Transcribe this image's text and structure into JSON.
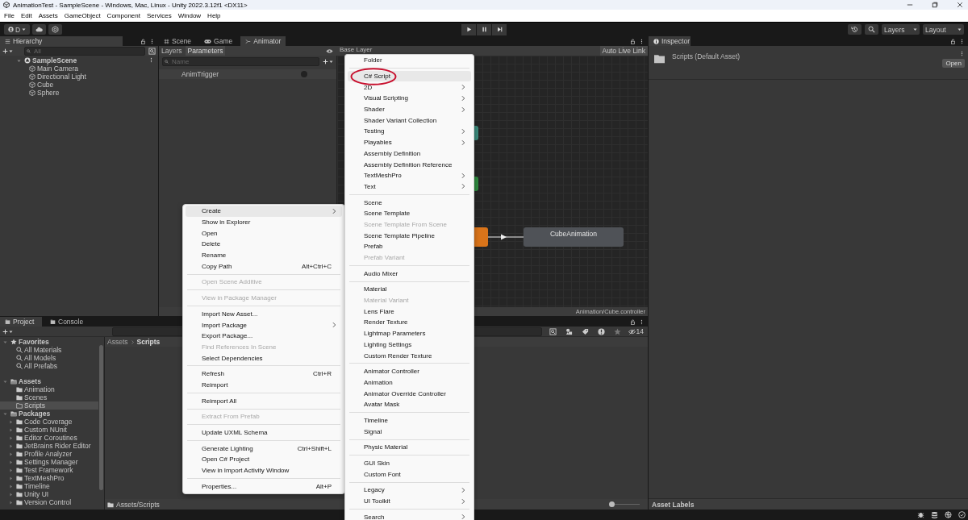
{
  "window": {
    "title": "AnimationTest - SampleScene - Windows, Mac, Linux - Unity 2022.3.12f1 <DX11>"
  },
  "menu_bar": [
    "File",
    "Edit",
    "Assets",
    "GameObject",
    "Component",
    "Services",
    "Window",
    "Help"
  ],
  "toolbar": {
    "account": "D",
    "layers": "Layers",
    "layout": "Layout"
  },
  "hierarchy": {
    "tab": "Hierarchy",
    "search": {
      "placeholder": "All"
    },
    "tree": [
      {
        "label": "SampleScene",
        "expanded": true,
        "selected": false,
        "children": [
          {
            "label": "Main Camera",
            "selected": false
          },
          {
            "label": "Directional Light",
            "selected": false
          },
          {
            "label": "Cube",
            "selected": false
          },
          {
            "label": "Sphere",
            "selected": false
          }
        ]
      }
    ]
  },
  "animator": {
    "tabs": [
      {
        "label": "Scene",
        "kind": "scene",
        "selected": false
      },
      {
        "label": "Game",
        "kind": "game",
        "selected": false
      },
      {
        "label": "Animator",
        "kind": "animator",
        "selected": true
      }
    ],
    "subtabs": [
      {
        "label": "Layers",
        "selected": false
      },
      {
        "label": "Parameters",
        "selected": true
      }
    ],
    "breadcrumb": "Base Layer",
    "auto_live_link": "Auto Live Link",
    "search": {
      "placeholder": "Name"
    },
    "parameters": [
      {
        "name": "AnimTrigger"
      }
    ],
    "nodes": [
      {
        "color": "#3c8a7c"
      },
      {
        "color": "#2f8a3f"
      },
      {
        "color": "#d9741a"
      },
      {
        "color": "#4f5257",
        "label": "CubeAnimation"
      }
    ],
    "footer": "Animation/Cube.controller"
  },
  "project": {
    "tabs": [
      {
        "label": "Project",
        "selected": true
      },
      {
        "label": "Console",
        "selected": false
      }
    ],
    "hidden_count": "14",
    "tree": [
      {
        "label": "Favorites",
        "kind": "favorites",
        "expanded": true,
        "selected": false,
        "children": [
          {
            "label": "All Materials",
            "kind": "search",
            "selected": false
          },
          {
            "label": "All Models",
            "kind": "search",
            "selected": false
          },
          {
            "label": "All Prefabs",
            "kind": "search",
            "selected": false
          }
        ]
      },
      {
        "label": "Assets",
        "kind": "folder",
        "expanded": true,
        "selected": false,
        "children": [
          {
            "label": "Animation",
            "kind": "folder",
            "selected": false
          },
          {
            "label": "Scenes",
            "kind": "folder",
            "selected": false
          },
          {
            "label": "Scripts",
            "kind": "folder",
            "selected": true
          }
        ]
      },
      {
        "label": "Packages",
        "kind": "folder",
        "expanded": true,
        "selected": false,
        "children": [
          {
            "label": "Code Coverage",
            "kind": "package",
            "expanded": false,
            "selected": false
          },
          {
            "label": "Custom NUnit",
            "kind": "package",
            "expanded": false,
            "selected": false
          },
          {
            "label": "Editor Coroutines",
            "kind": "package",
            "expanded": false,
            "selected": false
          },
          {
            "label": "JetBrains Rider Editor",
            "kind": "package",
            "expanded": false,
            "selected": false
          },
          {
            "label": "Profile Analyzer",
            "kind": "package",
            "expanded": false,
            "selected": false
          },
          {
            "label": "Settings Manager",
            "kind": "package",
            "expanded": false,
            "selected": false
          },
          {
            "label": "Test Framework",
            "kind": "package",
            "expanded": false,
            "selected": false
          },
          {
            "label": "TextMeshPro",
            "kind": "package",
            "expanded": false,
            "selected": false
          },
          {
            "label": "Timeline",
            "kind": "package",
            "expanded": false,
            "selected": false
          },
          {
            "label": "Unity UI",
            "kind": "package",
            "expanded": false,
            "selected": false
          },
          {
            "label": "Version Control",
            "kind": "package",
            "expanded": false,
            "selected": false
          }
        ]
      }
    ],
    "breadcrumb": [
      "Assets",
      "Scripts"
    ],
    "footer_path": "Assets/Scripts",
    "zoom_slider": {
      "level": 0
    }
  },
  "inspector": {
    "tab": "Inspector",
    "asset": "Scripts (Default Asset)",
    "open_button": "Open",
    "asset_labels": "Asset Labels"
  },
  "context_menu": {
    "sections": [
      [
        {
          "label": "Create",
          "submenu": true,
          "disabled": false,
          "selected": true
        },
        {
          "label": "Show in Explorer",
          "submenu": false,
          "disabled": false,
          "selected": false
        },
        {
          "label": "Open",
          "submenu": false,
          "disabled": false,
          "selected": false
        },
        {
          "label": "Delete",
          "submenu": false,
          "disabled": false,
          "selected": false
        },
        {
          "label": "Rename",
          "submenu": false,
          "disabled": false,
          "selected": false
        },
        {
          "label": "Copy Path",
          "shortcut": "Alt+Ctrl+C",
          "submenu": false,
          "disabled": false,
          "selected": false
        }
      ],
      [
        {
          "label": "Open Scene Additive",
          "submenu": false,
          "disabled": true,
          "selected": false
        }
      ],
      [
        {
          "label": "View in Package Manager",
          "submenu": false,
          "disabled": true,
          "selected": false
        }
      ],
      [
        {
          "label": "Import New Asset...",
          "submenu": false,
          "disabled": false,
          "selected": false
        },
        {
          "label": "Import Package",
          "submenu": true,
          "disabled": false,
          "selected": false
        },
        {
          "label": "Export Package...",
          "submenu": false,
          "disabled": false,
          "selected": false
        },
        {
          "label": "Find References In Scene",
          "submenu": false,
          "disabled": true,
          "selected": false
        },
        {
          "label": "Select Dependencies",
          "submenu": false,
          "disabled": false,
          "selected": false
        }
      ],
      [
        {
          "label": "Refresh",
          "shortcut": "Ctrl+R",
          "submenu": false,
          "disabled": false,
          "selected": false
        },
        {
          "label": "Reimport",
          "submenu": false,
          "disabled": false,
          "selected": false
        }
      ],
      [
        {
          "label": "Reimport All",
          "submenu": false,
          "disabled": false,
          "selected": false
        }
      ],
      [
        {
          "label": "Extract From Prefab",
          "submenu": false,
          "disabled": true,
          "selected": false
        }
      ],
      [
        {
          "label": "Update UXML Schema",
          "submenu": false,
          "disabled": false,
          "selected": false
        }
      ],
      [
        {
          "label": "Generate Lighting",
          "shortcut": "Ctrl+Shift+L",
          "submenu": false,
          "disabled": false,
          "selected": false
        },
        {
          "label": "Open C# Project",
          "submenu": false,
          "disabled": false,
          "selected": false
        },
        {
          "label": "View in Import Activity Window",
          "submenu": false,
          "disabled": false,
          "selected": false
        }
      ],
      [
        {
          "label": "Properties...",
          "shortcut": "Alt+P",
          "submenu": false,
          "disabled": false,
          "selected": false
        }
      ]
    ]
  },
  "create_submenu": {
    "sections": [
      [
        {
          "label": "Folder",
          "submenu": false,
          "disabled": false,
          "selected": false,
          "circled": false
        }
      ],
      [
        {
          "label": "C# Script",
          "submenu": false,
          "disabled": false,
          "selected": true,
          "circled": true
        },
        {
          "label": "2D",
          "submenu": true,
          "disabled": false,
          "selected": false,
          "circled": false
        },
        {
          "label": "Visual Scripting",
          "submenu": true,
          "disabled": false,
          "selected": false,
          "circled": false
        },
        {
          "label": "Shader",
          "submenu": true,
          "disabled": false,
          "selected": false,
          "circled": false
        },
        {
          "label": "Shader Variant Collection",
          "submenu": false,
          "disabled": false,
          "selected": false,
          "circled": false
        },
        {
          "label": "Testing",
          "submenu": true,
          "disabled": false,
          "selected": false,
          "circled": false
        },
        {
          "label": "Playables",
          "submenu": true,
          "disabled": false,
          "selected": false,
          "circled": false
        },
        {
          "label": "Assembly Definition",
          "submenu": false,
          "disabled": false,
          "selected": false,
          "circled": false
        },
        {
          "label": "Assembly Definition Reference",
          "submenu": false,
          "disabled": false,
          "selected": false,
          "circled": false
        },
        {
          "label": "TextMeshPro",
          "submenu": true,
          "disabled": false,
          "selected": false,
          "circled": false
        },
        {
          "label": "Text",
          "submenu": true,
          "disabled": false,
          "selected": false,
          "circled": false
        }
      ],
      [
        {
          "label": "Scene",
          "submenu": false,
          "disabled": false,
          "selected": false,
          "circled": false
        },
        {
          "label": "Scene Template",
          "submenu": false,
          "disabled": false,
          "selected": false,
          "circled": false
        },
        {
          "label": "Scene Template From Scene",
          "submenu": false,
          "disabled": true,
          "selected": false,
          "circled": false
        },
        {
          "label": "Scene Template Pipeline",
          "submenu": false,
          "disabled": false,
          "selected": false,
          "circled": false
        },
        {
          "label": "Prefab",
          "submenu": false,
          "disabled": false,
          "selected": false,
          "circled": false
        },
        {
          "label": "Prefab Variant",
          "submenu": false,
          "disabled": true,
          "selected": false,
          "circled": false
        }
      ],
      [
        {
          "label": "Audio Mixer",
          "submenu": false,
          "disabled": false,
          "selected": false,
          "circled": false
        }
      ],
      [
        {
          "label": "Material",
          "submenu": false,
          "disabled": false,
          "selected": false,
          "circled": false
        },
        {
          "label": "Material Variant",
          "submenu": false,
          "disabled": true,
          "selected": false,
          "circled": false
        },
        {
          "label": "Lens Flare",
          "submenu": false,
          "disabled": false,
          "selected": false,
          "circled": false
        },
        {
          "label": "Render Texture",
          "submenu": false,
          "disabled": false,
          "selected": false,
          "circled": false
        },
        {
          "label": "Lightmap Parameters",
          "submenu": false,
          "disabled": false,
          "selected": false,
          "circled": false
        },
        {
          "label": "Lighting Settings",
          "submenu": false,
          "disabled": false,
          "selected": false,
          "circled": false
        },
        {
          "label": "Custom Render Texture",
          "submenu": false,
          "disabled": false,
          "selected": false,
          "circled": false
        }
      ],
      [
        {
          "label": "Animator Controller",
          "submenu": false,
          "disabled": false,
          "selected": false,
          "circled": false
        },
        {
          "label": "Animation",
          "submenu": false,
          "disabled": false,
          "selected": false,
          "circled": false
        },
        {
          "label": "Animator Override Controller",
          "submenu": false,
          "disabled": false,
          "selected": false,
          "circled": false
        },
        {
          "label": "Avatar Mask",
          "submenu": false,
          "disabled": false,
          "selected": false,
          "circled": false
        }
      ],
      [
        {
          "label": "Timeline",
          "submenu": false,
          "disabled": false,
          "selected": false,
          "circled": false
        },
        {
          "label": "Signal",
          "submenu": false,
          "disabled": false,
          "selected": false,
          "circled": false
        }
      ],
      [
        {
          "label": "Physic Material",
          "submenu": false,
          "disabled": false,
          "selected": false,
          "circled": false
        }
      ],
      [
        {
          "label": "GUI Skin",
          "submenu": false,
          "disabled": false,
          "selected": false,
          "circled": false
        },
        {
          "label": "Custom Font",
          "submenu": false,
          "disabled": false,
          "selected": false,
          "circled": false
        }
      ],
      [
        {
          "label": "Legacy",
          "submenu": true,
          "disabled": false,
          "selected": false,
          "circled": false
        },
        {
          "label": "UI Toolkit",
          "submenu": true,
          "disabled": false,
          "selected": false,
          "circled": false
        }
      ],
      [
        {
          "label": "Search",
          "submenu": true,
          "disabled": false,
          "selected": false,
          "circled": false
        }
      ]
    ]
  }
}
